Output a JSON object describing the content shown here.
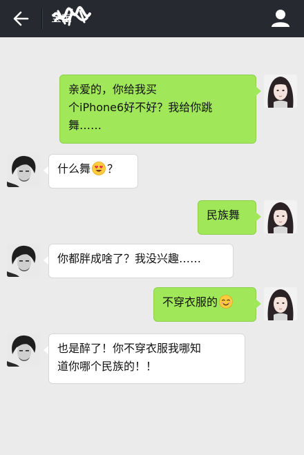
{
  "header": {
    "contact_name": "宝宝",
    "back_icon": "arrow-left-icon",
    "profile_icon": "person-icon"
  },
  "colors": {
    "topbar": "#262a30",
    "background": "#ebebeb",
    "outgoing_bubble": "#a0e75a",
    "incoming_bubble": "#ffffff"
  },
  "messages": [
    {
      "direction": "outgoing",
      "text_lines": [
        "亲爱的，你给我买",
        "个iPhone6好不好？我给你跳",
        "舞……"
      ]
    },
    {
      "direction": "incoming",
      "text_before_emoji": "什么舞",
      "emoji": "heart-eyes-emoji",
      "text_after_emoji": "？"
    },
    {
      "direction": "outgoing",
      "text": "民族舞"
    },
    {
      "direction": "incoming",
      "text": "你都胖成啥了？我没兴趣……"
    },
    {
      "direction": "outgoing",
      "text_before_emoji": "不穿衣服的",
      "emoji": "blush-emoji"
    },
    {
      "direction": "incoming",
      "text_lines": [
        "也是醉了！你不穿衣服我哪知",
        "道你哪个民族的！！"
      ]
    }
  ]
}
